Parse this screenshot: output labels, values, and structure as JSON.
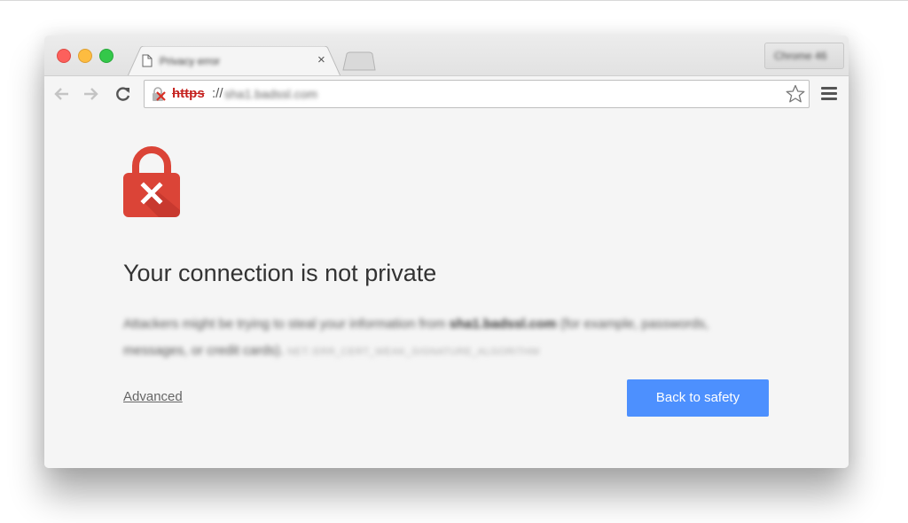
{
  "window": {
    "tab": {
      "title": "Privacy error",
      "icon": "file-icon",
      "close_label": "×"
    },
    "profile_button_label": "Chrome 46",
    "toolbar": {
      "back_icon": "arrow-left-icon",
      "forward_icon": "arrow-right-icon",
      "reload_icon": "reload-icon",
      "url_scheme": "https",
      "url_separator": "://",
      "url_host": "sha1.badssl.com",
      "security_icon": "broken-lock-icon",
      "bookmark_icon": "star-icon",
      "menu_icon": "hamburger-icon"
    }
  },
  "page": {
    "icon": "red-lock-x-icon",
    "heading": "Your connection is not private",
    "paragraph": {
      "prefix": "Attackers might be trying to steal your information from ",
      "host": "sha1.badssl.com",
      "suffix": " (for example, passwords, messages, or credit cards). ",
      "error_code": "NET::ERR_CERT_WEAK_SIGNATURE_ALGORITHM"
    },
    "advanced_label": "Advanced",
    "back_to_safety_label": "Back to safety"
  },
  "colors": {
    "danger": "#db4437",
    "primary_button": "#4d90fe",
    "scheme_error": "#c5221f"
  }
}
